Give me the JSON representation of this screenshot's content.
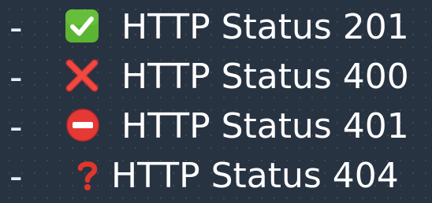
{
  "list": {
    "items": [
      {
        "bullet": "-",
        "icon": "check-mark-button-icon",
        "text": "HTTP Status 201"
      },
      {
        "bullet": "-",
        "icon": "cross-mark-icon",
        "text": "HTTP Status 400"
      },
      {
        "bullet": "-",
        "icon": "no-entry-icon",
        "text": "HTTP Status 401"
      },
      {
        "bullet": "-",
        "icon": "red-question-mark-icon",
        "text": "HTTP Status 404"
      }
    ]
  },
  "colors": {
    "background": "#283342",
    "text": "#ffffff",
    "success_green": "#5cb532",
    "error_red": "#e53935",
    "question_red": "#e0362c"
  }
}
